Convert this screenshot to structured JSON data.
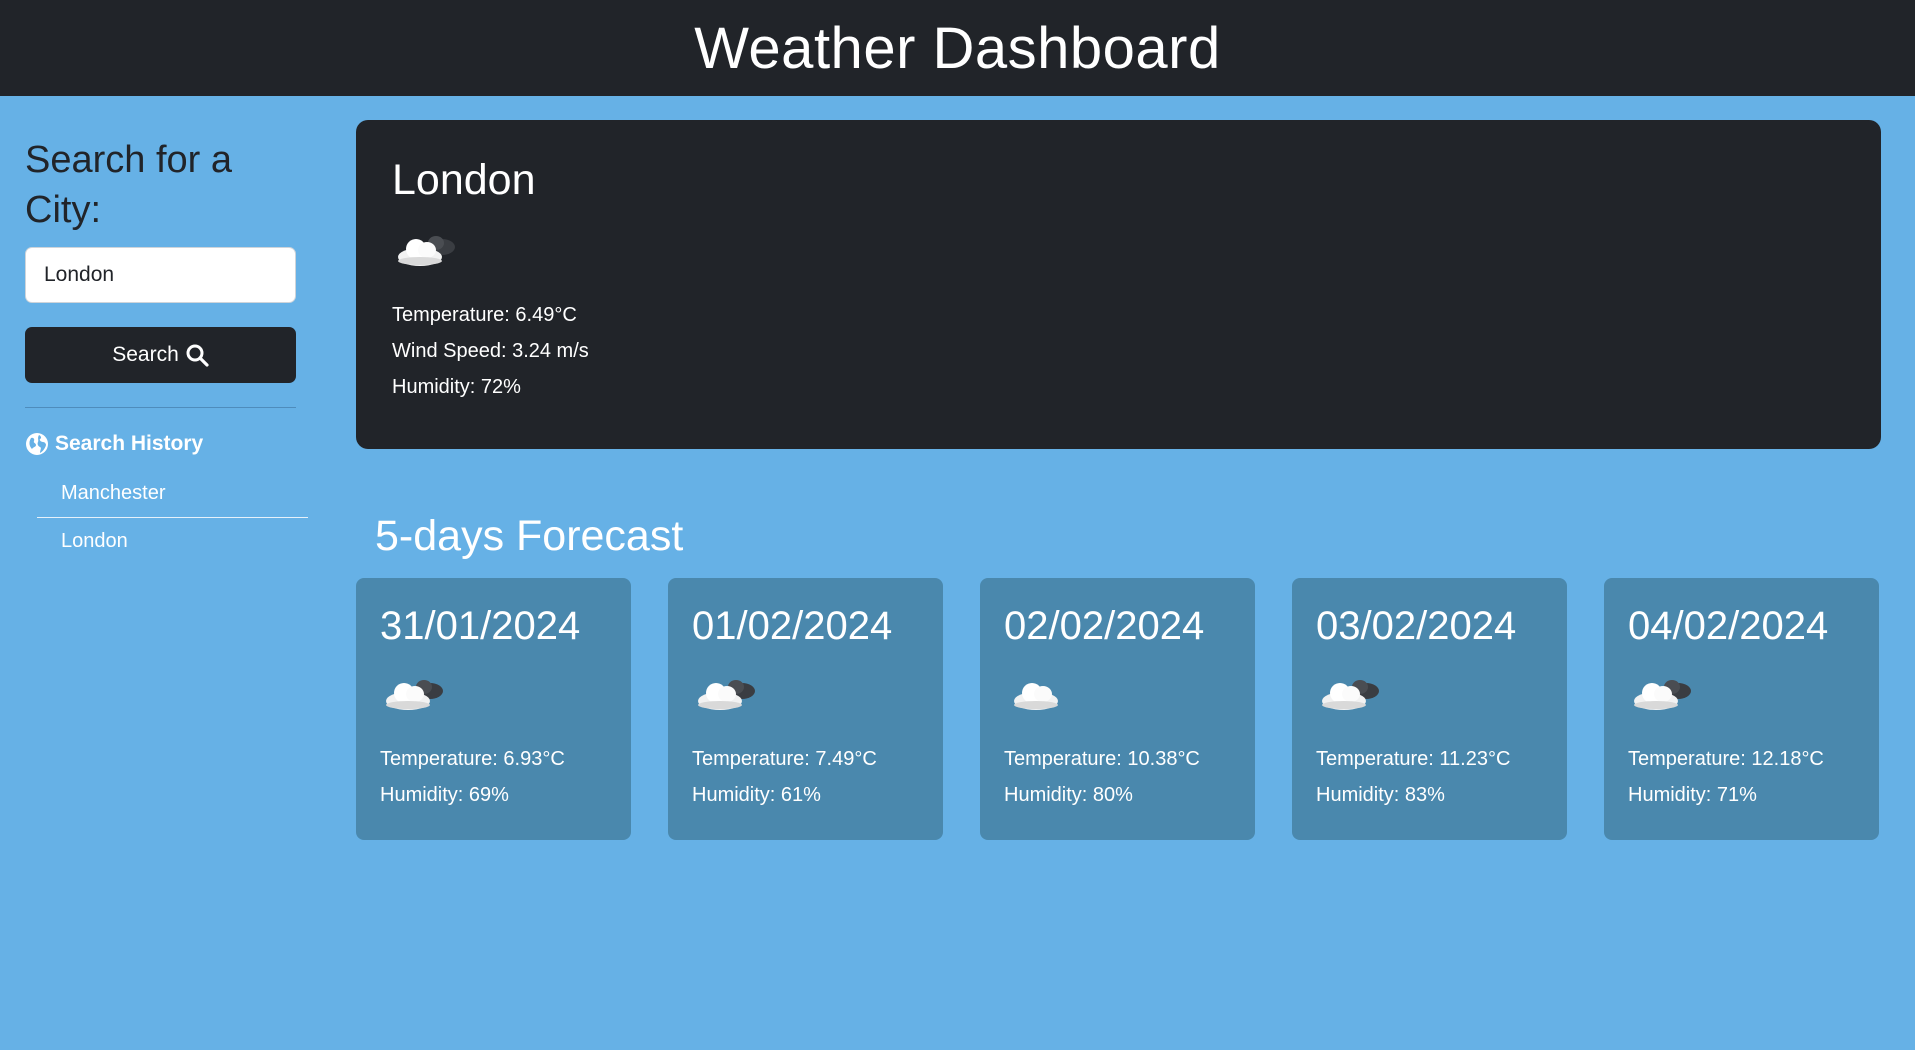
{
  "header": {
    "title": "Weather Dashboard"
  },
  "sidebar": {
    "search_title": "Search for a City:",
    "input_value": "London",
    "search_label": "Search",
    "search_icon": "magnifier-icon",
    "history_title": "Search History",
    "history_icon": "globe-icon",
    "history": [
      "Manchester",
      "London"
    ]
  },
  "current": {
    "city": "London",
    "icon": "cloudy-icon",
    "temperature": "Temperature: 6.49°C",
    "wind": "Wind Speed: 3.24 m/s",
    "humidity": "Humidity: 72%"
  },
  "forecast": {
    "title": "5-days Forecast",
    "days": [
      {
        "date": "31/01/2024",
        "icon": "partly-cloudy-icon",
        "temperature": "Temperature: 6.93°C",
        "humidity": "Humidity: 69%"
      },
      {
        "date": "01/02/2024",
        "icon": "partly-cloudy-icon",
        "temperature": "Temperature: 7.49°C",
        "humidity": "Humidity: 61%"
      },
      {
        "date": "02/02/2024",
        "icon": "cloud-icon",
        "temperature": "Temperature: 10.38°C",
        "humidity": "Humidity: 80%"
      },
      {
        "date": "03/02/2024",
        "icon": "partly-cloudy-icon",
        "temperature": "Temperature: 11.23°C",
        "humidity": "Humidity: 83%"
      },
      {
        "date": "04/02/2024",
        "icon": "partly-cloudy-icon",
        "temperature": "Temperature: 12.18°C",
        "humidity": "Humidity: 71%"
      }
    ]
  },
  "colors": {
    "background": "#66b1e6",
    "dark": "#212429",
    "card": "#4a88ad"
  }
}
